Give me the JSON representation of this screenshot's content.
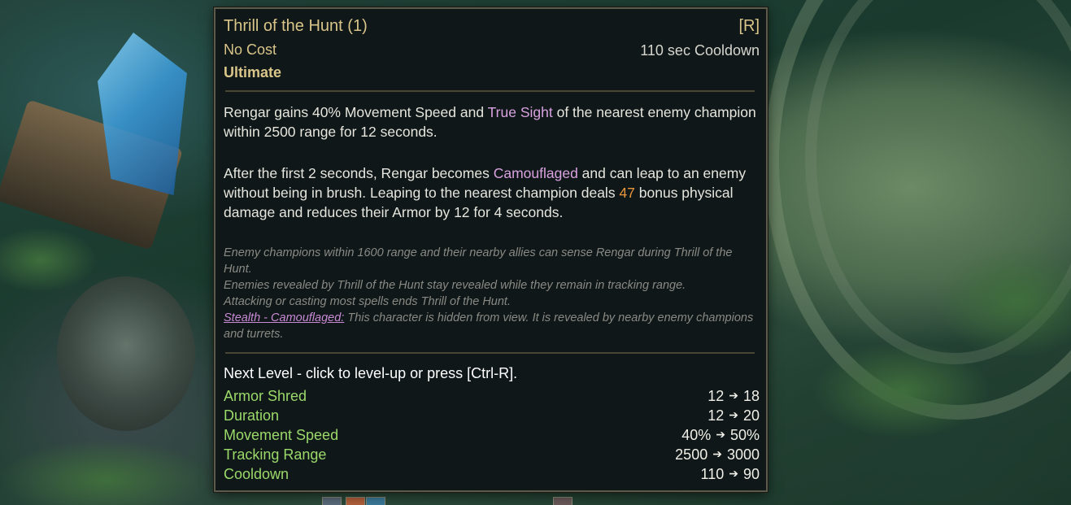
{
  "ability": {
    "name": "Thrill of the Hunt (1)",
    "hotkey": "[R]",
    "cost": "No Cost",
    "cooldown": "110 sec Cooldown",
    "type": "Ultimate"
  },
  "description": {
    "p1_a": "Rengar gains 40% Movement Speed and ",
    "p1_true_sight": "True Sight",
    "p1_b": " of the nearest enemy champion within 2500 range for 12 seconds.",
    "p2_a": "After the first 2 seconds, Rengar becomes ",
    "p2_camouflaged": "Camouflaged",
    "p2_b": " and can leap to an enemy without being in brush. Leaping to the nearest champion deals ",
    "p2_damage": "47",
    "p2_c": " bonus physical damage and reduces their Armor by 12 for 4 seconds."
  },
  "notes": {
    "line1": "Enemy champions within 1600 range and their nearby allies can sense Rengar during Thrill of the Hunt.",
    "line2": "Enemies revealed by Thrill of the Hunt stay revealed while they remain in tracking range.",
    "line3": "Attacking or casting most spells ends Thrill of the Hunt.",
    "stealth_link": "Stealth - Camouflaged:",
    "stealth_text": " This character is hidden from view. It is revealed by nearby enemy champions and turrets."
  },
  "next_level": {
    "prompt": "Next Level - click to level-up or press [Ctrl-R].",
    "stats": [
      {
        "name": "Armor Shred",
        "from": "12",
        "to": "18"
      },
      {
        "name": "Duration",
        "from": "12",
        "to": "20"
      },
      {
        "name": "Movement Speed",
        "from": "40%",
        "to": "50%"
      },
      {
        "name": "Tracking Range",
        "from": "2500",
        "to": "3000"
      },
      {
        "name": "Cooldown",
        "from": "110",
        "to": "90"
      }
    ],
    "arrow": "➔"
  },
  "colors": {
    "title_gold": "#d9c58a",
    "keyword_purple": "#d9a2e0",
    "damage_orange": "#e8963c",
    "stat_green": "#9bd96a",
    "panel_bg": "#0f1718"
  }
}
